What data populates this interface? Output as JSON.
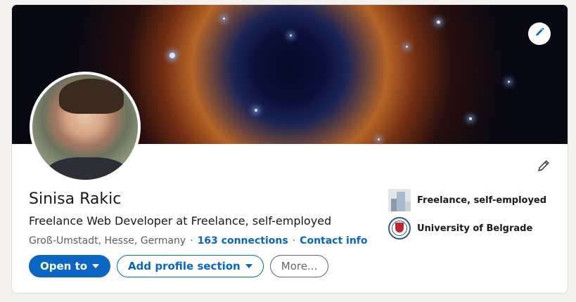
{
  "profile": {
    "name": "Sinisa Rakic",
    "headline": "Freelance Web Developer at Freelance, self-employed",
    "location": "Groß-Umstadt, Hesse, Germany",
    "connections": "163 connections",
    "contact_info": "Contact info"
  },
  "actions": {
    "open_to": "Open to",
    "add_section": "Add profile section",
    "more": "More..."
  },
  "side": {
    "items": [
      {
        "label": "Freelance, self-employed",
        "icon": "company-logo-icon"
      },
      {
        "label": "University of Belgrade",
        "icon": "university-logo-icon"
      }
    ]
  },
  "colors": {
    "accent": "#0a66c2",
    "background": "#f3f2ef",
    "card": "#ffffff"
  }
}
